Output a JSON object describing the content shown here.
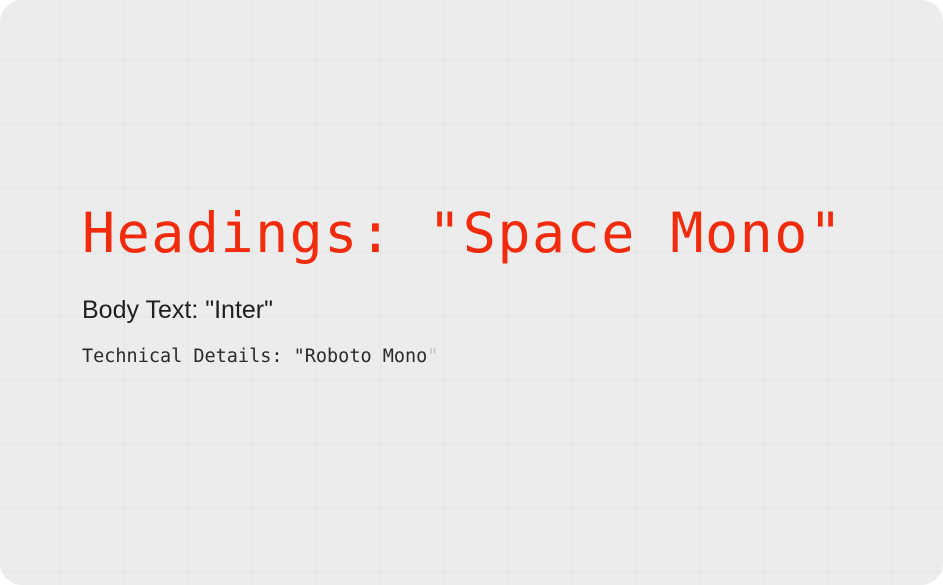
{
  "colors": {
    "background": "#ececec",
    "heading": "#f12b0c",
    "body_text": "#1f1f1f",
    "technical": "#2a2a2a"
  },
  "typography": {
    "heading": "Headings: \"Space Mono\"",
    "body": "Body Text: \"Inter\"",
    "technical_prefix": "Technical Details: ",
    "technical_open_quote": "\"",
    "technical_font_name": "Roboto Mono",
    "technical_close_quote": "\""
  }
}
